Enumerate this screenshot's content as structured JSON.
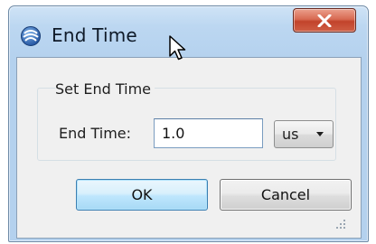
{
  "window": {
    "title": "End Time",
    "icon": "globe-app-icon",
    "close_icon": "x-close-icon",
    "colors": {
      "titlebar": "#b9d5f0",
      "close_button": "#c9533a",
      "client": "#f0f0f0"
    }
  },
  "group": {
    "label": "Set End Time",
    "field_label": "End Time:",
    "end_time_value": "1.0",
    "unit_selected": "us"
  },
  "buttons": {
    "ok_label": "OK",
    "cancel_label": "Cancel"
  },
  "decorations": {
    "cursor": "mouse-pointer-icon",
    "grip": "resize-grip-icon"
  }
}
